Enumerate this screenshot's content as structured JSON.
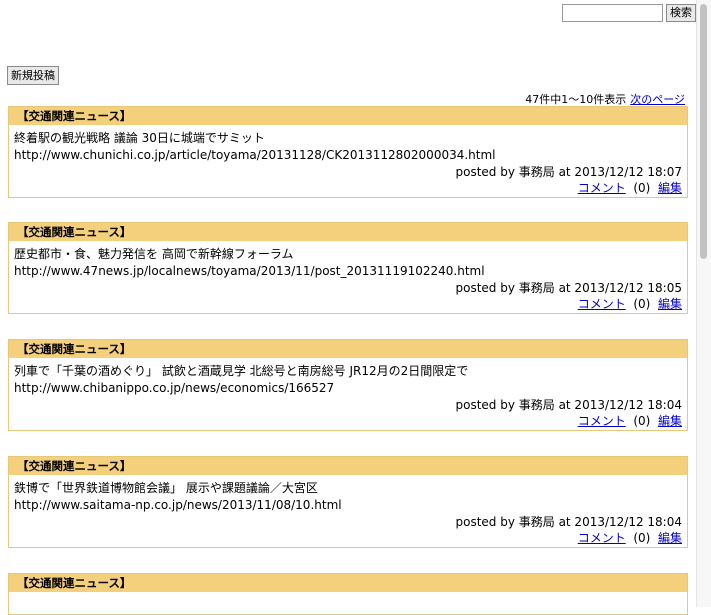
{
  "search": {
    "value": "",
    "button": "検索"
  },
  "new_post_button": "新規投稿",
  "pager": {
    "summary": "47件中1～10件表示",
    "next_label": "次のページ"
  },
  "entries": [
    {
      "category": "【交通関連ニュース】",
      "title": "終着駅の観光戦略 議論 30日に城端でサミット",
      "url": "http://www.chunichi.co.jp/article/toyama/20131128/CK2013112802000034.html",
      "posted": "posted by 事務局 at 2013/12/12 18:07",
      "comment_label": "コメント",
      "comment_count": "(0)",
      "edit_label": "編集"
    },
    {
      "category": "【交通関連ニュース】",
      "title": "歴史都市・食、魅力発信を 高岡で新幹線フォーラム",
      "url": "http://www.47news.jp/localnews/toyama/2013/11/post_20131119102240.html",
      "posted": "posted by 事務局 at 2013/12/12 18:05",
      "comment_label": "コメント",
      "comment_count": "(0)",
      "edit_label": "編集"
    },
    {
      "category": "【交通関連ニュース】",
      "title": "列車で「千葉の酒めぐり」 試飲と酒蔵見学 北総号と南房総号 JR12月の2日間限定で",
      "url": "http://www.chibanippo.co.jp/news/economics/166527",
      "posted": "posted by 事務局 at 2013/12/12 18:04",
      "comment_label": "コメント",
      "comment_count": "(0)",
      "edit_label": "編集"
    },
    {
      "category": "【交通関連ニュース】",
      "title": "鉄博で「世界鉄道博物館会議」 展示や課題議論／大宮区",
      "url": "http://www.saitama-np.co.jp/news/2013/11/08/10.html",
      "posted": "posted by 事務局 at 2013/12/12 18:04",
      "comment_label": "コメント",
      "comment_count": "(0)",
      "edit_label": "編集"
    },
    {
      "category": "【交通関連ニュース】"
    }
  ]
}
